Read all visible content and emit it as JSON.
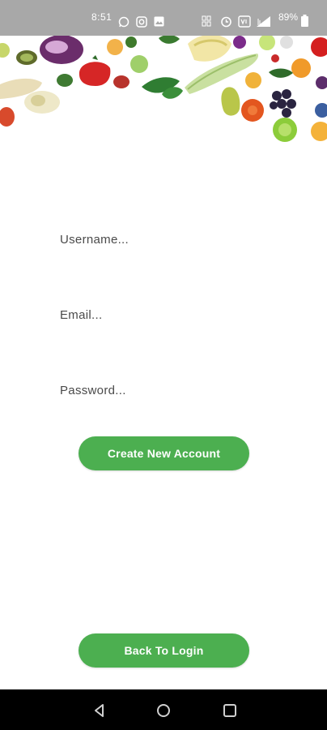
{
  "status_bar": {
    "time": "8:51",
    "battery_percent": "89%",
    "icons": [
      "whatsapp-icon",
      "instagram-icon",
      "gallery-icon",
      "data-icon",
      "alarm-icon",
      "volte-icon",
      "signal-icon",
      "battery-icon"
    ]
  },
  "banner": {
    "description_icon": "vegetables-banner"
  },
  "form": {
    "username_placeholder": "Username...",
    "email_placeholder": "Email...",
    "password_placeholder": "Password..."
  },
  "buttons": {
    "create_label": "Create New Account",
    "back_label": "Back To Login"
  },
  "colors": {
    "accent": "#4caf50",
    "status_bar_bg": "#a8a8a8",
    "nav_bar_bg": "#000000"
  },
  "nav": {
    "icons": [
      "back-icon",
      "home-icon",
      "recents-icon"
    ]
  }
}
